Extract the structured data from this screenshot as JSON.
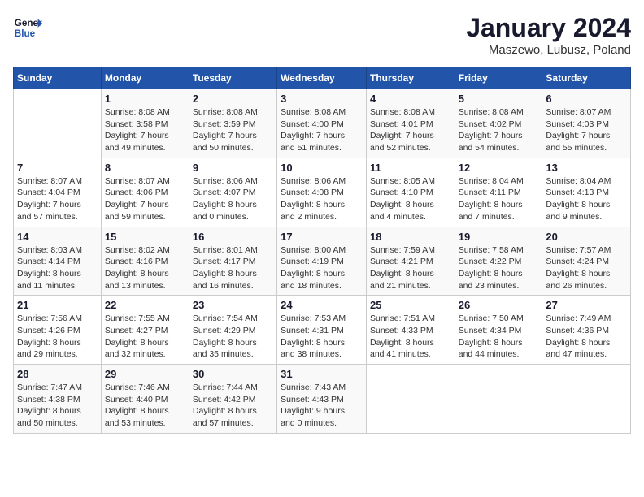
{
  "header": {
    "logo_general": "General",
    "logo_blue": "Blue",
    "month_title": "January 2024",
    "location": "Maszewo, Lubusz, Poland"
  },
  "days_of_week": [
    "Sunday",
    "Monday",
    "Tuesday",
    "Wednesday",
    "Thursday",
    "Friday",
    "Saturday"
  ],
  "weeks": [
    [
      {
        "day": "",
        "info": ""
      },
      {
        "day": "1",
        "info": "Sunrise: 8:08 AM\nSunset: 3:58 PM\nDaylight: 7 hours\nand 49 minutes."
      },
      {
        "day": "2",
        "info": "Sunrise: 8:08 AM\nSunset: 3:59 PM\nDaylight: 7 hours\nand 50 minutes."
      },
      {
        "day": "3",
        "info": "Sunrise: 8:08 AM\nSunset: 4:00 PM\nDaylight: 7 hours\nand 51 minutes."
      },
      {
        "day": "4",
        "info": "Sunrise: 8:08 AM\nSunset: 4:01 PM\nDaylight: 7 hours\nand 52 minutes."
      },
      {
        "day": "5",
        "info": "Sunrise: 8:08 AM\nSunset: 4:02 PM\nDaylight: 7 hours\nand 54 minutes."
      },
      {
        "day": "6",
        "info": "Sunrise: 8:07 AM\nSunset: 4:03 PM\nDaylight: 7 hours\nand 55 minutes."
      }
    ],
    [
      {
        "day": "7",
        "info": "Sunrise: 8:07 AM\nSunset: 4:04 PM\nDaylight: 7 hours\nand 57 minutes."
      },
      {
        "day": "8",
        "info": "Sunrise: 8:07 AM\nSunset: 4:06 PM\nDaylight: 7 hours\nand 59 minutes."
      },
      {
        "day": "9",
        "info": "Sunrise: 8:06 AM\nSunset: 4:07 PM\nDaylight: 8 hours\nand 0 minutes."
      },
      {
        "day": "10",
        "info": "Sunrise: 8:06 AM\nSunset: 4:08 PM\nDaylight: 8 hours\nand 2 minutes."
      },
      {
        "day": "11",
        "info": "Sunrise: 8:05 AM\nSunset: 4:10 PM\nDaylight: 8 hours\nand 4 minutes."
      },
      {
        "day": "12",
        "info": "Sunrise: 8:04 AM\nSunset: 4:11 PM\nDaylight: 8 hours\nand 7 minutes."
      },
      {
        "day": "13",
        "info": "Sunrise: 8:04 AM\nSunset: 4:13 PM\nDaylight: 8 hours\nand 9 minutes."
      }
    ],
    [
      {
        "day": "14",
        "info": "Sunrise: 8:03 AM\nSunset: 4:14 PM\nDaylight: 8 hours\nand 11 minutes."
      },
      {
        "day": "15",
        "info": "Sunrise: 8:02 AM\nSunset: 4:16 PM\nDaylight: 8 hours\nand 13 minutes."
      },
      {
        "day": "16",
        "info": "Sunrise: 8:01 AM\nSunset: 4:17 PM\nDaylight: 8 hours\nand 16 minutes."
      },
      {
        "day": "17",
        "info": "Sunrise: 8:00 AM\nSunset: 4:19 PM\nDaylight: 8 hours\nand 18 minutes."
      },
      {
        "day": "18",
        "info": "Sunrise: 7:59 AM\nSunset: 4:21 PM\nDaylight: 8 hours\nand 21 minutes."
      },
      {
        "day": "19",
        "info": "Sunrise: 7:58 AM\nSunset: 4:22 PM\nDaylight: 8 hours\nand 23 minutes."
      },
      {
        "day": "20",
        "info": "Sunrise: 7:57 AM\nSunset: 4:24 PM\nDaylight: 8 hours\nand 26 minutes."
      }
    ],
    [
      {
        "day": "21",
        "info": "Sunrise: 7:56 AM\nSunset: 4:26 PM\nDaylight: 8 hours\nand 29 minutes."
      },
      {
        "day": "22",
        "info": "Sunrise: 7:55 AM\nSunset: 4:27 PM\nDaylight: 8 hours\nand 32 minutes."
      },
      {
        "day": "23",
        "info": "Sunrise: 7:54 AM\nSunset: 4:29 PM\nDaylight: 8 hours\nand 35 minutes."
      },
      {
        "day": "24",
        "info": "Sunrise: 7:53 AM\nSunset: 4:31 PM\nDaylight: 8 hours\nand 38 minutes."
      },
      {
        "day": "25",
        "info": "Sunrise: 7:51 AM\nSunset: 4:33 PM\nDaylight: 8 hours\nand 41 minutes."
      },
      {
        "day": "26",
        "info": "Sunrise: 7:50 AM\nSunset: 4:34 PM\nDaylight: 8 hours\nand 44 minutes."
      },
      {
        "day": "27",
        "info": "Sunrise: 7:49 AM\nSunset: 4:36 PM\nDaylight: 8 hours\nand 47 minutes."
      }
    ],
    [
      {
        "day": "28",
        "info": "Sunrise: 7:47 AM\nSunset: 4:38 PM\nDaylight: 8 hours\nand 50 minutes."
      },
      {
        "day": "29",
        "info": "Sunrise: 7:46 AM\nSunset: 4:40 PM\nDaylight: 8 hours\nand 53 minutes."
      },
      {
        "day": "30",
        "info": "Sunrise: 7:44 AM\nSunset: 4:42 PM\nDaylight: 8 hours\nand 57 minutes."
      },
      {
        "day": "31",
        "info": "Sunrise: 7:43 AM\nSunset: 4:43 PM\nDaylight: 9 hours\nand 0 minutes."
      },
      {
        "day": "",
        "info": ""
      },
      {
        "day": "",
        "info": ""
      },
      {
        "day": "",
        "info": ""
      }
    ]
  ]
}
